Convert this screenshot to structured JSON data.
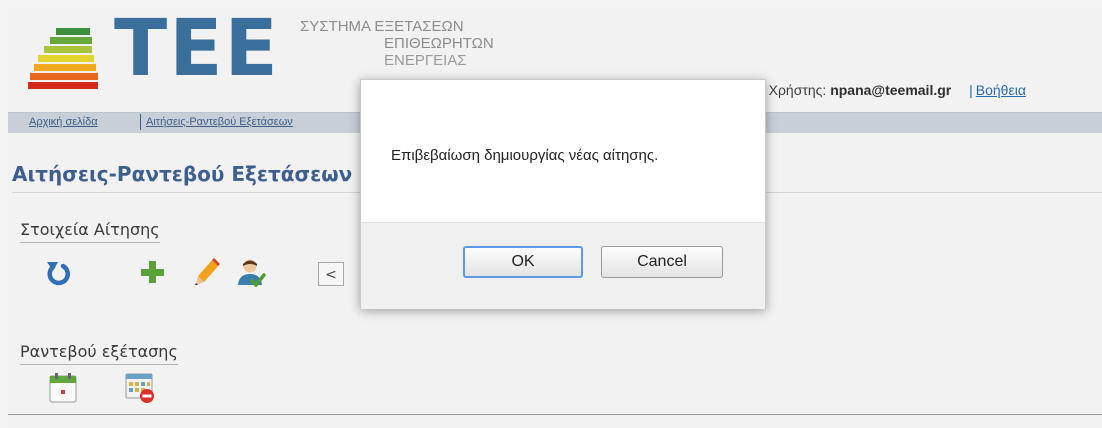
{
  "header": {
    "logo_text": "TEE",
    "system_title_lines": [
      "ΣΥΣΤΗΜΑ ΕΞΕΤΑΣΕΩΝ",
      "ΕΠΙΘΕΩΡΗΤΩΝ",
      "ΕΝΕΡΓΕΙΑΣ"
    ],
    "user_prefix": "ΙΠΣ Συνδεμένος Χρήστης:",
    "user_email": "npana@teemail.gr",
    "help_separator": "|",
    "help_label": "Βοήθεια"
  },
  "nav": {
    "items": [
      {
        "label": "Αρχική σελίδα"
      },
      {
        "label": "Αιτήσεις-Ραντεβού Εξετάσεων"
      }
    ]
  },
  "main": {
    "page_title": "Αιτήσεις-Ραντεβού Εξετάσεων",
    "section_application": "Στοιχεία Αίτησης",
    "prev_button": "<",
    "section_appointment": "Ραντεβού εξέτασης"
  },
  "icons": {
    "toolbar": [
      "refresh-icon",
      "add-icon",
      "edit-icon",
      "user-icon"
    ],
    "appointment": [
      "calendar-icon",
      "calendar-delete-icon"
    ]
  },
  "dialog": {
    "message": "Επιβεβαίωση δημιουργίας νέας αίτησης.",
    "ok_label": "OK",
    "cancel_label": "Cancel"
  },
  "colors": {
    "brand_blue": "#3a6f9c",
    "title_blue": "#3e5f8d",
    "link_blue": "#2a6aa8",
    "focus_blue": "#5b9be6"
  }
}
